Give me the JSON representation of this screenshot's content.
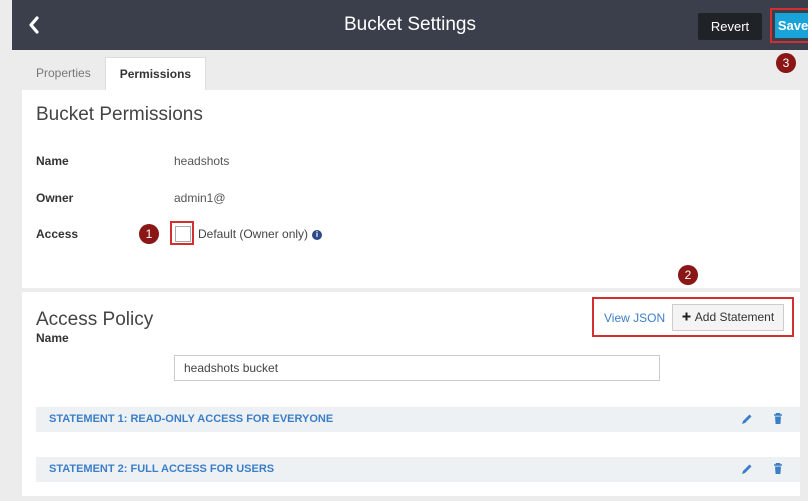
{
  "header": {
    "title": "Bucket Settings",
    "revert_label": "Revert",
    "save_label": "Save",
    "save_marker": "3"
  },
  "tabs": [
    {
      "label": "Properties"
    },
    {
      "label": "Permissions"
    }
  ],
  "permissions": {
    "heading": "Bucket Permissions",
    "name_label": "Name",
    "name_value": "headshots",
    "owner_label": "Owner",
    "owner_value": "admin1@",
    "access_label": "Access",
    "access_marker": "1",
    "access_option": "Default (Owner only)",
    "access_checked": false
  },
  "policy": {
    "heading": "Access Policy",
    "actions_marker": "2",
    "view_json_label": "View JSON",
    "add_statement_label": "Add Statement",
    "name_label": "Name",
    "name_value": "headshots bucket",
    "statements": [
      {
        "label": "STATEMENT 1: READ-ONLY ACCESS FOR EVERYONE"
      },
      {
        "label": "STATEMENT 2: FULL ACCESS FOR USERS"
      }
    ]
  },
  "colors": {
    "header_bg": "#3a3f4b",
    "save_bg": "#1aa3d9",
    "highlight": "#d32f2f",
    "badge": "#8a1616",
    "link": "#3b7ec7"
  }
}
